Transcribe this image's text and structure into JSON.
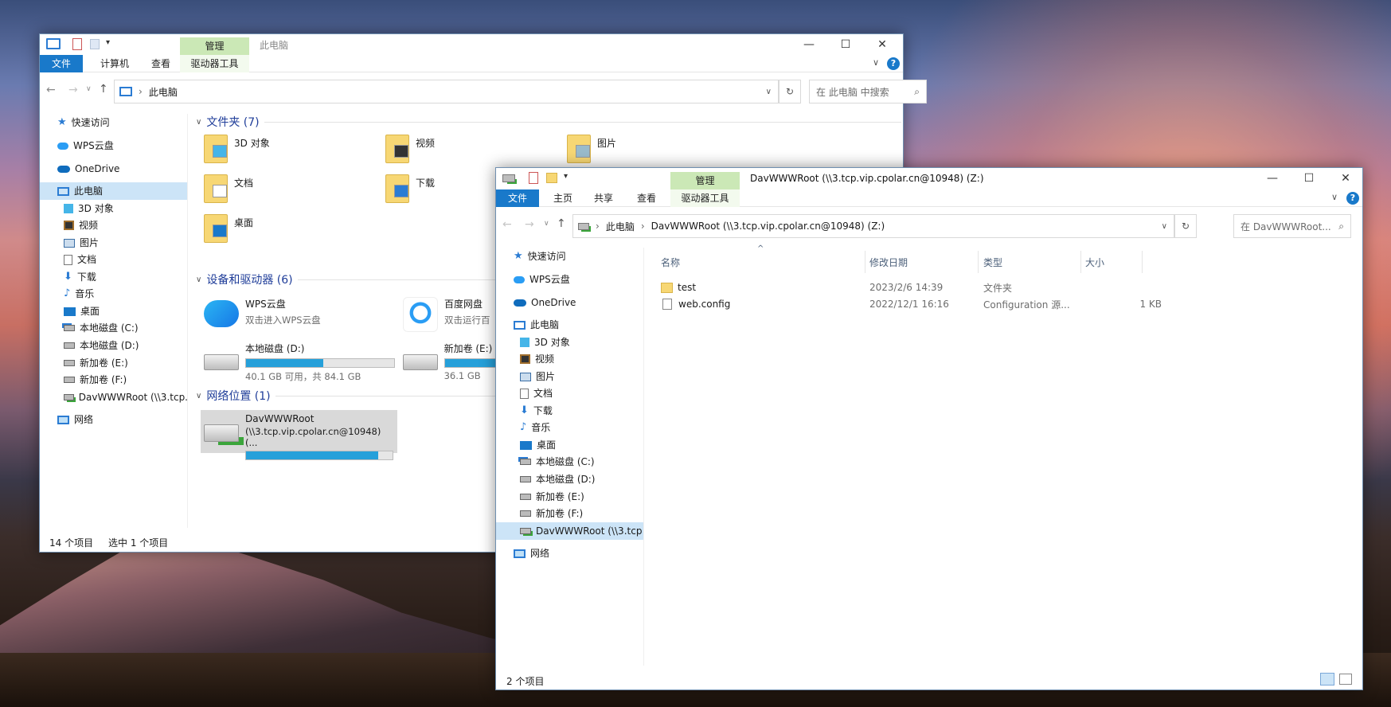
{
  "window_back": {
    "title": "此电脑",
    "ribbon": {
      "file": "文件",
      "computer": "计算机",
      "view": "查看",
      "manage": "管理",
      "drive_tools": "驱动器工具"
    },
    "controls": {
      "minimize": "—",
      "maximize": "☐",
      "close": "✕",
      "chevron": "∨",
      "help": "?"
    },
    "address": {
      "path": "此电脑",
      "refresh": "↻"
    },
    "search_placeholder": "在 此电脑 中搜索",
    "sidebar": [
      {
        "label": "快速访问",
        "icon": "star-icon"
      },
      {
        "label": "WPS云盘",
        "icon": "cloud-icon"
      },
      {
        "label": "OneDrive",
        "icon": "onedrive-icon"
      },
      {
        "label": "此电脑",
        "icon": "computer-icon"
      },
      {
        "label": "3D 对象",
        "icon": "cube-icon"
      },
      {
        "label": "视频",
        "icon": "video-icon"
      },
      {
        "label": "图片",
        "icon": "picture-icon"
      },
      {
        "label": "文档",
        "icon": "document-icon"
      },
      {
        "label": "下载",
        "icon": "download-icon"
      },
      {
        "label": "音乐",
        "icon": "music-icon"
      },
      {
        "label": "桌面",
        "icon": "desktop-icon"
      },
      {
        "label": "本地磁盘 (C:)",
        "icon": "system-drive-icon"
      },
      {
        "label": "本地磁盘 (D:)",
        "icon": "drive-icon"
      },
      {
        "label": "新加卷 (E:)",
        "icon": "drive-icon"
      },
      {
        "label": "新加卷 (F:)",
        "icon": "drive-icon"
      },
      {
        "label": "DavWWWRoot (\\\\3.tcp.",
        "icon": "network-drive-icon"
      },
      {
        "label": "网络",
        "icon": "network-icon"
      }
    ],
    "groups": {
      "folders": "文件夹 (7)",
      "devices": "设备和驱动器 (6)",
      "network": "网络位置 (1)"
    },
    "folders": [
      {
        "label": "3D 对象"
      },
      {
        "label": "视频"
      },
      {
        "label": "图片"
      },
      {
        "label": "文档"
      },
      {
        "label": "下载"
      },
      {
        "label": "桌面"
      }
    ],
    "devices": [
      {
        "label": "WPS云盘",
        "sub": "双击进入WPS云盘"
      },
      {
        "label": "百度网盘",
        "sub": "双击运行百"
      },
      {
        "label": "本地磁盘 (D:)",
        "sub": "40.1 GB 可用，共 84.1 GB",
        "used": 0.52
      },
      {
        "label": "新加卷 (E:)",
        "sub": "36.1 GB",
        "used": 0.6
      }
    ],
    "network_loc": {
      "label": "DavWWWRoot",
      "sub": "(\\\\3.tcp.vip.cpolar.cn@10948) (...",
      "used": 0.9
    },
    "status": {
      "count": "14 个项目",
      "selected": "选中 1 个项目"
    }
  },
  "window_front": {
    "title": "DavWWWRoot (\\\\3.tcp.vip.cpolar.cn@10948) (Z:)",
    "ribbon": {
      "file": "文件",
      "home": "主页",
      "share": "共享",
      "view": "查看",
      "manage": "管理",
      "drive_tools": "驱动器工具"
    },
    "controls": {
      "minimize": "—",
      "maximize": "☐",
      "close": "✕",
      "chevron": "∨",
      "help": "?"
    },
    "address": {
      "seg1": "此电脑",
      "seg2": "DavWWWRoot (\\\\3.tcp.vip.cpolar.cn@10948) (Z:)",
      "refresh": "↻"
    },
    "search_placeholder": "在 DavWWWRoot...",
    "sidebar": [
      {
        "label": "快速访问",
        "icon": "star-icon"
      },
      {
        "label": "WPS云盘",
        "icon": "cloud-icon"
      },
      {
        "label": "OneDrive",
        "icon": "onedrive-icon"
      },
      {
        "label": "此电脑",
        "icon": "computer-icon"
      },
      {
        "label": "3D 对象",
        "icon": "cube-icon"
      },
      {
        "label": "视频",
        "icon": "video-icon"
      },
      {
        "label": "图片",
        "icon": "picture-icon"
      },
      {
        "label": "文档",
        "icon": "document-icon"
      },
      {
        "label": "下载",
        "icon": "download-icon"
      },
      {
        "label": "音乐",
        "icon": "music-icon"
      },
      {
        "label": "桌面",
        "icon": "desktop-icon"
      },
      {
        "label": "本地磁盘 (C:)",
        "icon": "system-drive-icon"
      },
      {
        "label": "本地磁盘 (D:)",
        "icon": "drive-icon"
      },
      {
        "label": "新加卷 (E:)",
        "icon": "drive-icon"
      },
      {
        "label": "新加卷 (F:)",
        "icon": "drive-icon"
      },
      {
        "label": "DavWWWRoot (\\\\3.tcp",
        "icon": "network-drive-icon"
      },
      {
        "label": "网络",
        "icon": "network-icon"
      }
    ],
    "columns": {
      "name": "名称",
      "date": "修改日期",
      "type": "类型",
      "size": "大小",
      "sort_arrow": "^"
    },
    "files": [
      {
        "name": "test",
        "date": "2023/2/6 14:39",
        "type": "文件夹",
        "size": ""
      },
      {
        "name": "web.config",
        "date": "2022/12/1 16:16",
        "type": "Configuration 源...",
        "size": "1 KB"
      }
    ],
    "status": {
      "count": "2 个项目"
    }
  },
  "colors": {
    "accent": "#1979ca",
    "manage_tab": "#cbe8b6",
    "selection": "#cce4f7",
    "group_title": "#1f3d99",
    "bar_fill": "#26a0da"
  }
}
